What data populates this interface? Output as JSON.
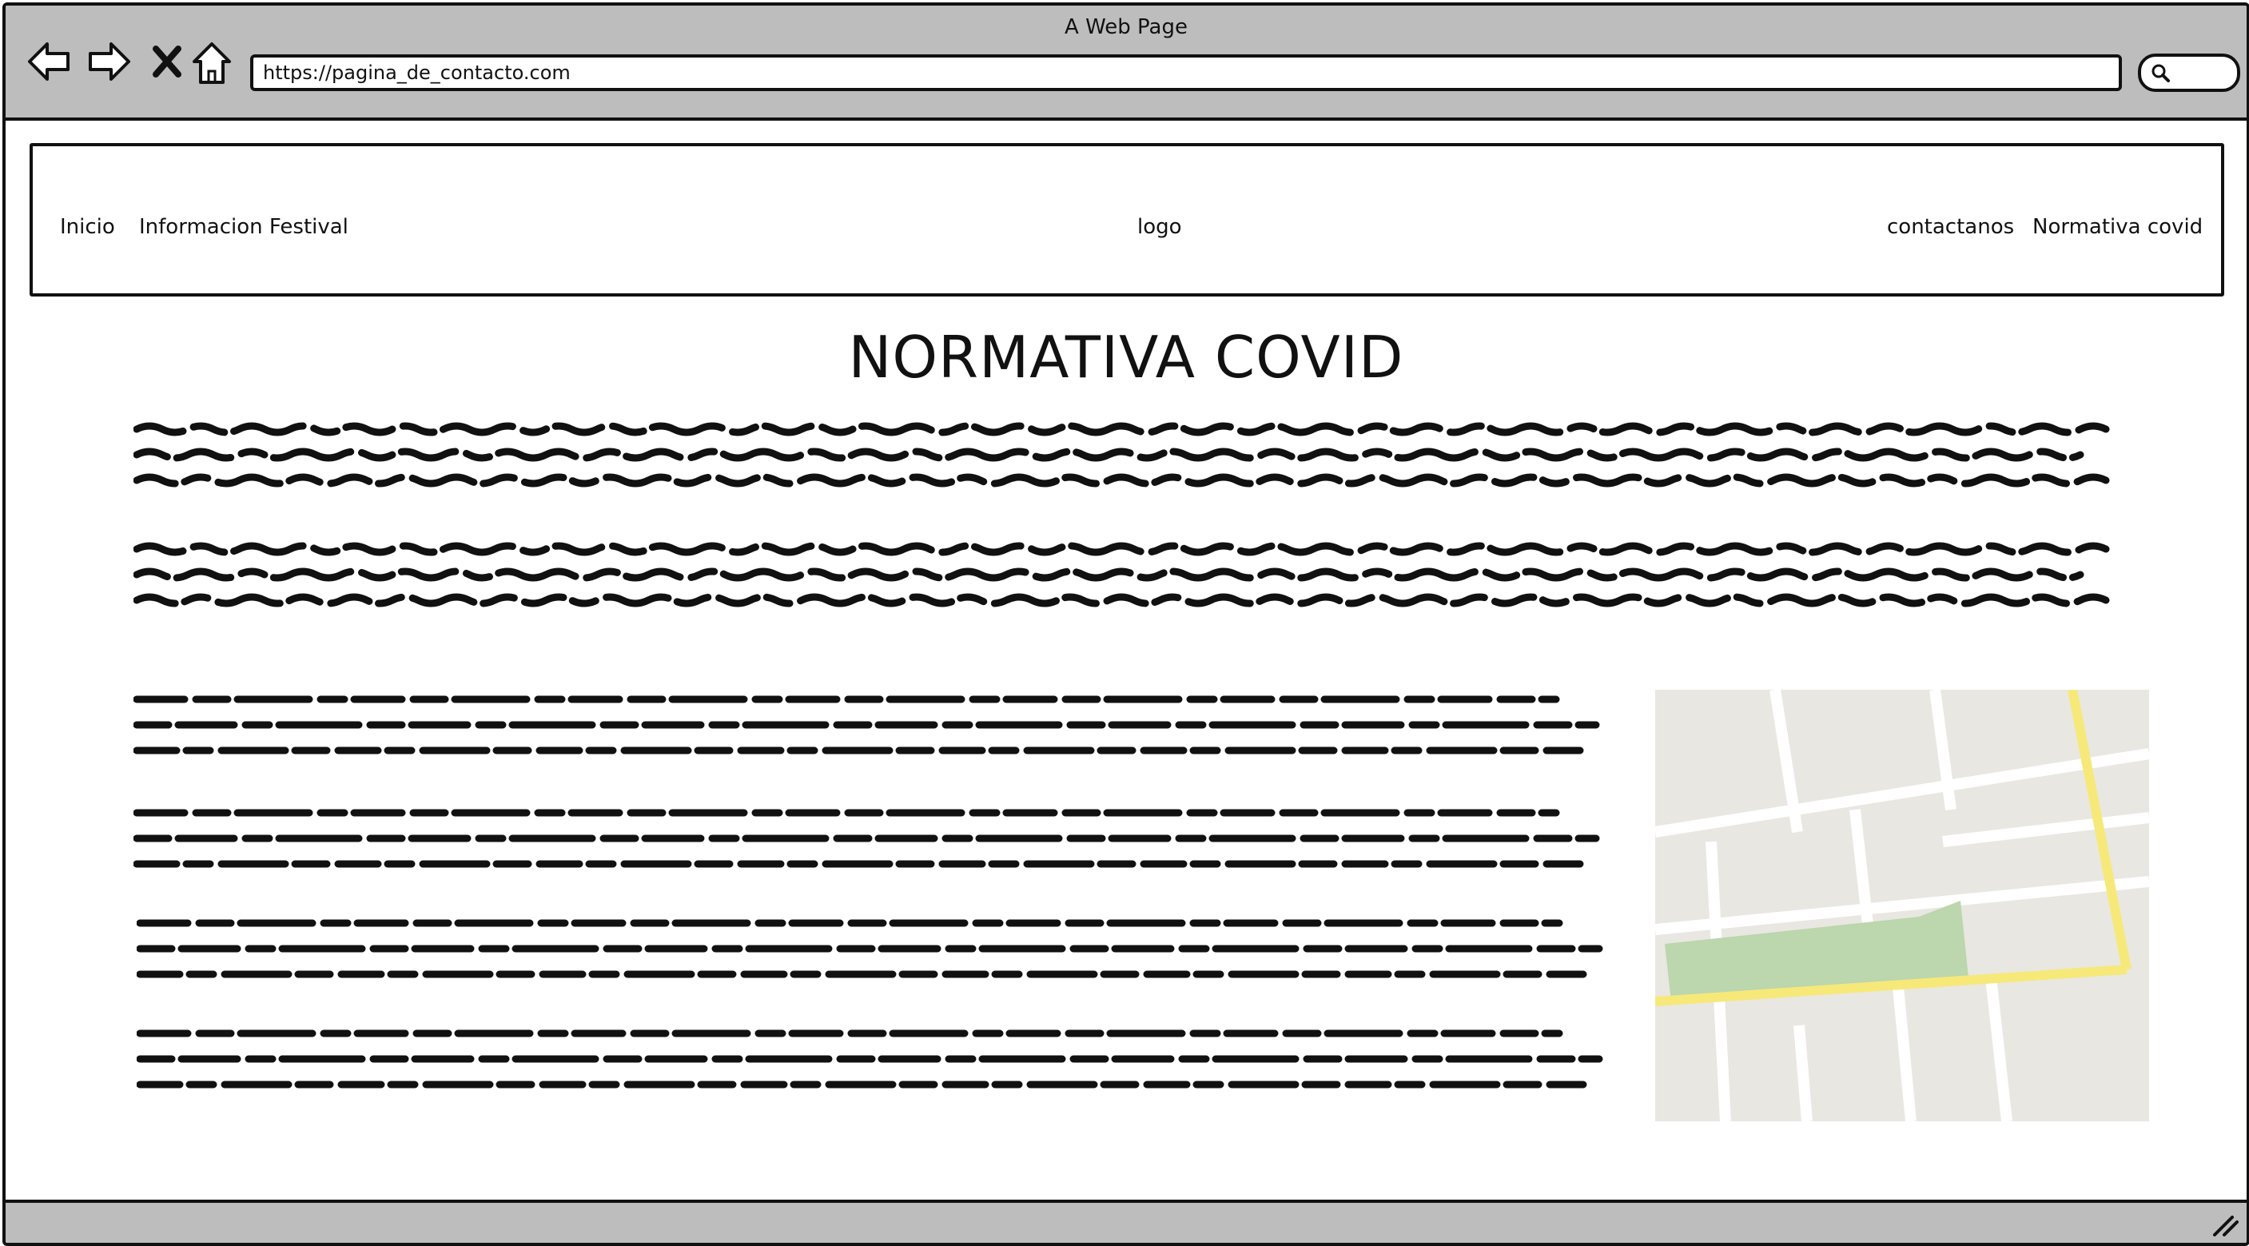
{
  "window": {
    "title": "A Web Page"
  },
  "browser": {
    "url": "https://pagina_de_contacto.com",
    "icons": [
      "back-arrow-icon",
      "forward-arrow-icon",
      "close-x-icon",
      "home-icon",
      "search-icon"
    ]
  },
  "header": {
    "nav_left": [
      "Inicio",
      "Informacion Festival"
    ],
    "logo": "logo",
    "nav_right": [
      "contactanos",
      "Normativa covid"
    ]
  },
  "main": {
    "title": "NORMATIVA COVID",
    "full_width_paragraphs": 2,
    "side_paragraphs": 4
  },
  "map": {
    "colors": {
      "background": "#e9e7e1",
      "road": "#ffffff",
      "highway": "#f6e97a",
      "park": "#bcd6ad"
    }
  }
}
